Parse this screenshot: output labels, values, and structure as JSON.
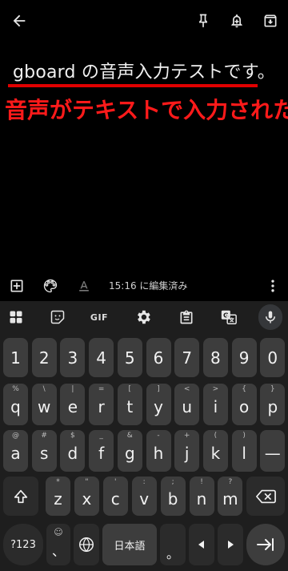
{
  "note": {
    "text": "gboard の音声入力テストです。",
    "annotation": "音声がテキストで入力された"
  },
  "notebar": {
    "status": "15:16 に編集済み"
  },
  "keyboard": {
    "toolbar": {
      "gif_label": "GIF"
    },
    "row_numbers": [
      "1",
      "2",
      "3",
      "4",
      "5",
      "6",
      "7",
      "8",
      "9",
      "0"
    ],
    "row1": [
      {
        "main": "q",
        "hint": "%"
      },
      {
        "main": "w",
        "hint": "\\"
      },
      {
        "main": "e",
        "hint": "|"
      },
      {
        "main": "r",
        "hint": "="
      },
      {
        "main": "t",
        "hint": "["
      },
      {
        "main": "y",
        "hint": "]"
      },
      {
        "main": "u",
        "hint": "<"
      },
      {
        "main": "i",
        "hint": ">"
      },
      {
        "main": "o",
        "hint": "{"
      },
      {
        "main": "p",
        "hint": "}"
      }
    ],
    "row2": [
      {
        "main": "a",
        "hint": "@"
      },
      {
        "main": "s",
        "hint": "#"
      },
      {
        "main": "d",
        "hint": "$"
      },
      {
        "main": "f",
        "hint": "_"
      },
      {
        "main": "g",
        "hint": "&"
      },
      {
        "main": "h",
        "hint": "-"
      },
      {
        "main": "j",
        "hint": "+"
      },
      {
        "main": "k",
        "hint": "("
      },
      {
        "main": "l",
        "hint": ")"
      },
      {
        "main": "—",
        "hint": ""
      }
    ],
    "row3": [
      {
        "main": "z",
        "hint": "*"
      },
      {
        "main": "x",
        "hint": "\""
      },
      {
        "main": "c",
        "hint": "'"
      },
      {
        "main": "v",
        "hint": ":"
      },
      {
        "main": "b",
        "hint": ";"
      },
      {
        "main": "n",
        "hint": "!"
      },
      {
        "main": "m",
        "hint": "?"
      }
    ],
    "bottom": {
      "symbols_label": "?123",
      "emoji_hint": "☺",
      "comma_label": "、",
      "space_label": "日本語",
      "period_label": "。"
    }
  }
}
